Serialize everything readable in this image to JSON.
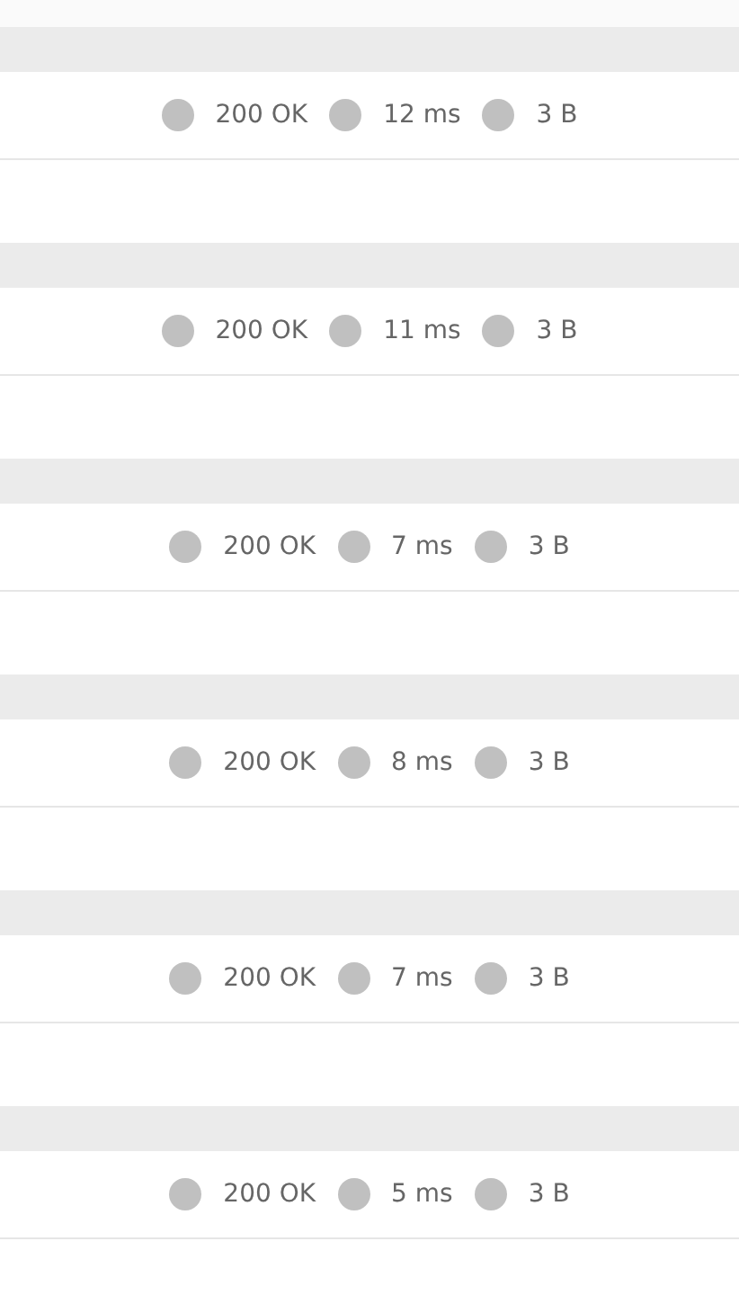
{
  "responses": [
    {
      "status": "200 OK",
      "time": "12 ms",
      "size": "3 B"
    },
    {
      "status": "200 OK",
      "time": "11 ms",
      "size": "3 B"
    },
    {
      "status": "200 OK",
      "time": "7 ms",
      "size": "3 B"
    },
    {
      "status": "200 OK",
      "time": "8 ms",
      "size": "3 B"
    },
    {
      "status": "200 OK",
      "time": "7 ms",
      "size": "3 B"
    },
    {
      "status": "200 OK",
      "time": "5 ms",
      "size": "3 B"
    }
  ]
}
